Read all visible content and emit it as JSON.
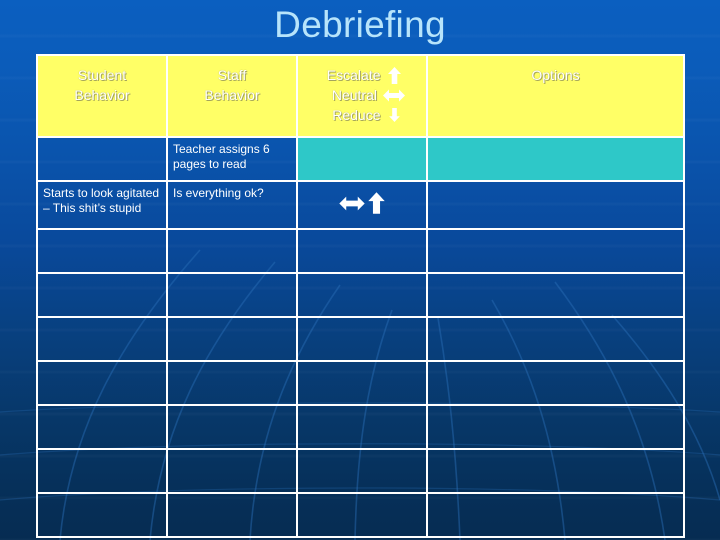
{
  "slide": {
    "title": "Debriefing",
    "title_color": "#b7e4fb",
    "background_top_color": "#0b5fc0",
    "background_bottom_color": "#062c52",
    "header_fill": "#ffff66",
    "header_text_color": "#ffffff",
    "highlight_fill": "#2ec8c8",
    "border_color": "#ffffff"
  },
  "table": {
    "columns": [
      {
        "key": "student_behavior",
        "label_line1": "Student",
        "label_line2": "Behavior"
      },
      {
        "key": "staff_behavior",
        "label_line1": "Staff",
        "label_line2": "Behavior"
      },
      {
        "key": "escalate_neutral_reduce",
        "label_line1": "Escalate",
        "label_line2": "Neutral",
        "label_line3": "Reduce"
      },
      {
        "key": "options",
        "label_line1": "Options"
      }
    ],
    "legend": [
      {
        "label": "Escalate",
        "icon": "arrow-up-icon"
      },
      {
        "label": "Neutral",
        "icon": "arrow-left-right-icon"
      },
      {
        "label": "Reduce",
        "icon": "arrow-down-icon"
      }
    ],
    "rows": [
      {
        "student_behavior": "",
        "staff_behavior": "Teacher assigns 6 pages to read",
        "rating_icons": [],
        "options": "",
        "rating_cell_highlight": true,
        "options_cell_highlight": true
      },
      {
        "student_behavior": "Starts to look agitated – This shit’s stupid",
        "staff_behavior": "Is everything ok?",
        "rating_icons": [
          "arrow-left-right-icon",
          "arrow-up-icon"
        ],
        "options": "",
        "rating_cell_highlight": false,
        "options_cell_highlight": false
      },
      {
        "student_behavior": "",
        "staff_behavior": "",
        "rating_icons": [],
        "options": "",
        "rating_cell_highlight": false,
        "options_cell_highlight": false
      },
      {
        "student_behavior": "",
        "staff_behavior": "",
        "rating_icons": [],
        "options": "",
        "rating_cell_highlight": false,
        "options_cell_highlight": false
      },
      {
        "student_behavior": "",
        "staff_behavior": "",
        "rating_icons": [],
        "options": "",
        "rating_cell_highlight": false,
        "options_cell_highlight": false
      },
      {
        "student_behavior": "",
        "staff_behavior": "",
        "rating_icons": [],
        "options": "",
        "rating_cell_highlight": false,
        "options_cell_highlight": false
      },
      {
        "student_behavior": "",
        "staff_behavior": "",
        "rating_icons": [],
        "options": "",
        "rating_cell_highlight": false,
        "options_cell_highlight": false
      },
      {
        "student_behavior": "",
        "staff_behavior": "",
        "rating_icons": [],
        "options": "",
        "rating_cell_highlight": false,
        "options_cell_highlight": false
      },
      {
        "student_behavior": "",
        "staff_behavior": "",
        "rating_icons": [],
        "options": "",
        "rating_cell_highlight": false,
        "options_cell_highlight": false
      }
    ]
  }
}
